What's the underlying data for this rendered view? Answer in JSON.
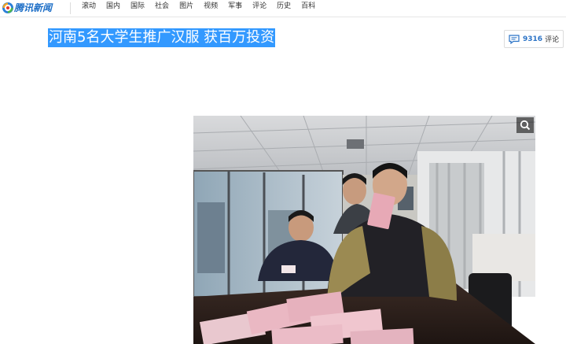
{
  "brand": {
    "name": "腾讯新闻",
    "color": "#1e6fc7"
  },
  "nav": {
    "items": [
      "滚动",
      "国内",
      "国际",
      "社会",
      "图片",
      "视频",
      "军事",
      "评论",
      "历史",
      "百科"
    ]
  },
  "article": {
    "title": "河南5名大学生推广汉服 获百万投资",
    "selection_color": "#3399ff"
  },
  "comments": {
    "count": "9316",
    "label": "评论",
    "icon": "comment-bubble-icon"
  },
  "photo": {
    "zoom_icon": "magnifier-icon"
  }
}
